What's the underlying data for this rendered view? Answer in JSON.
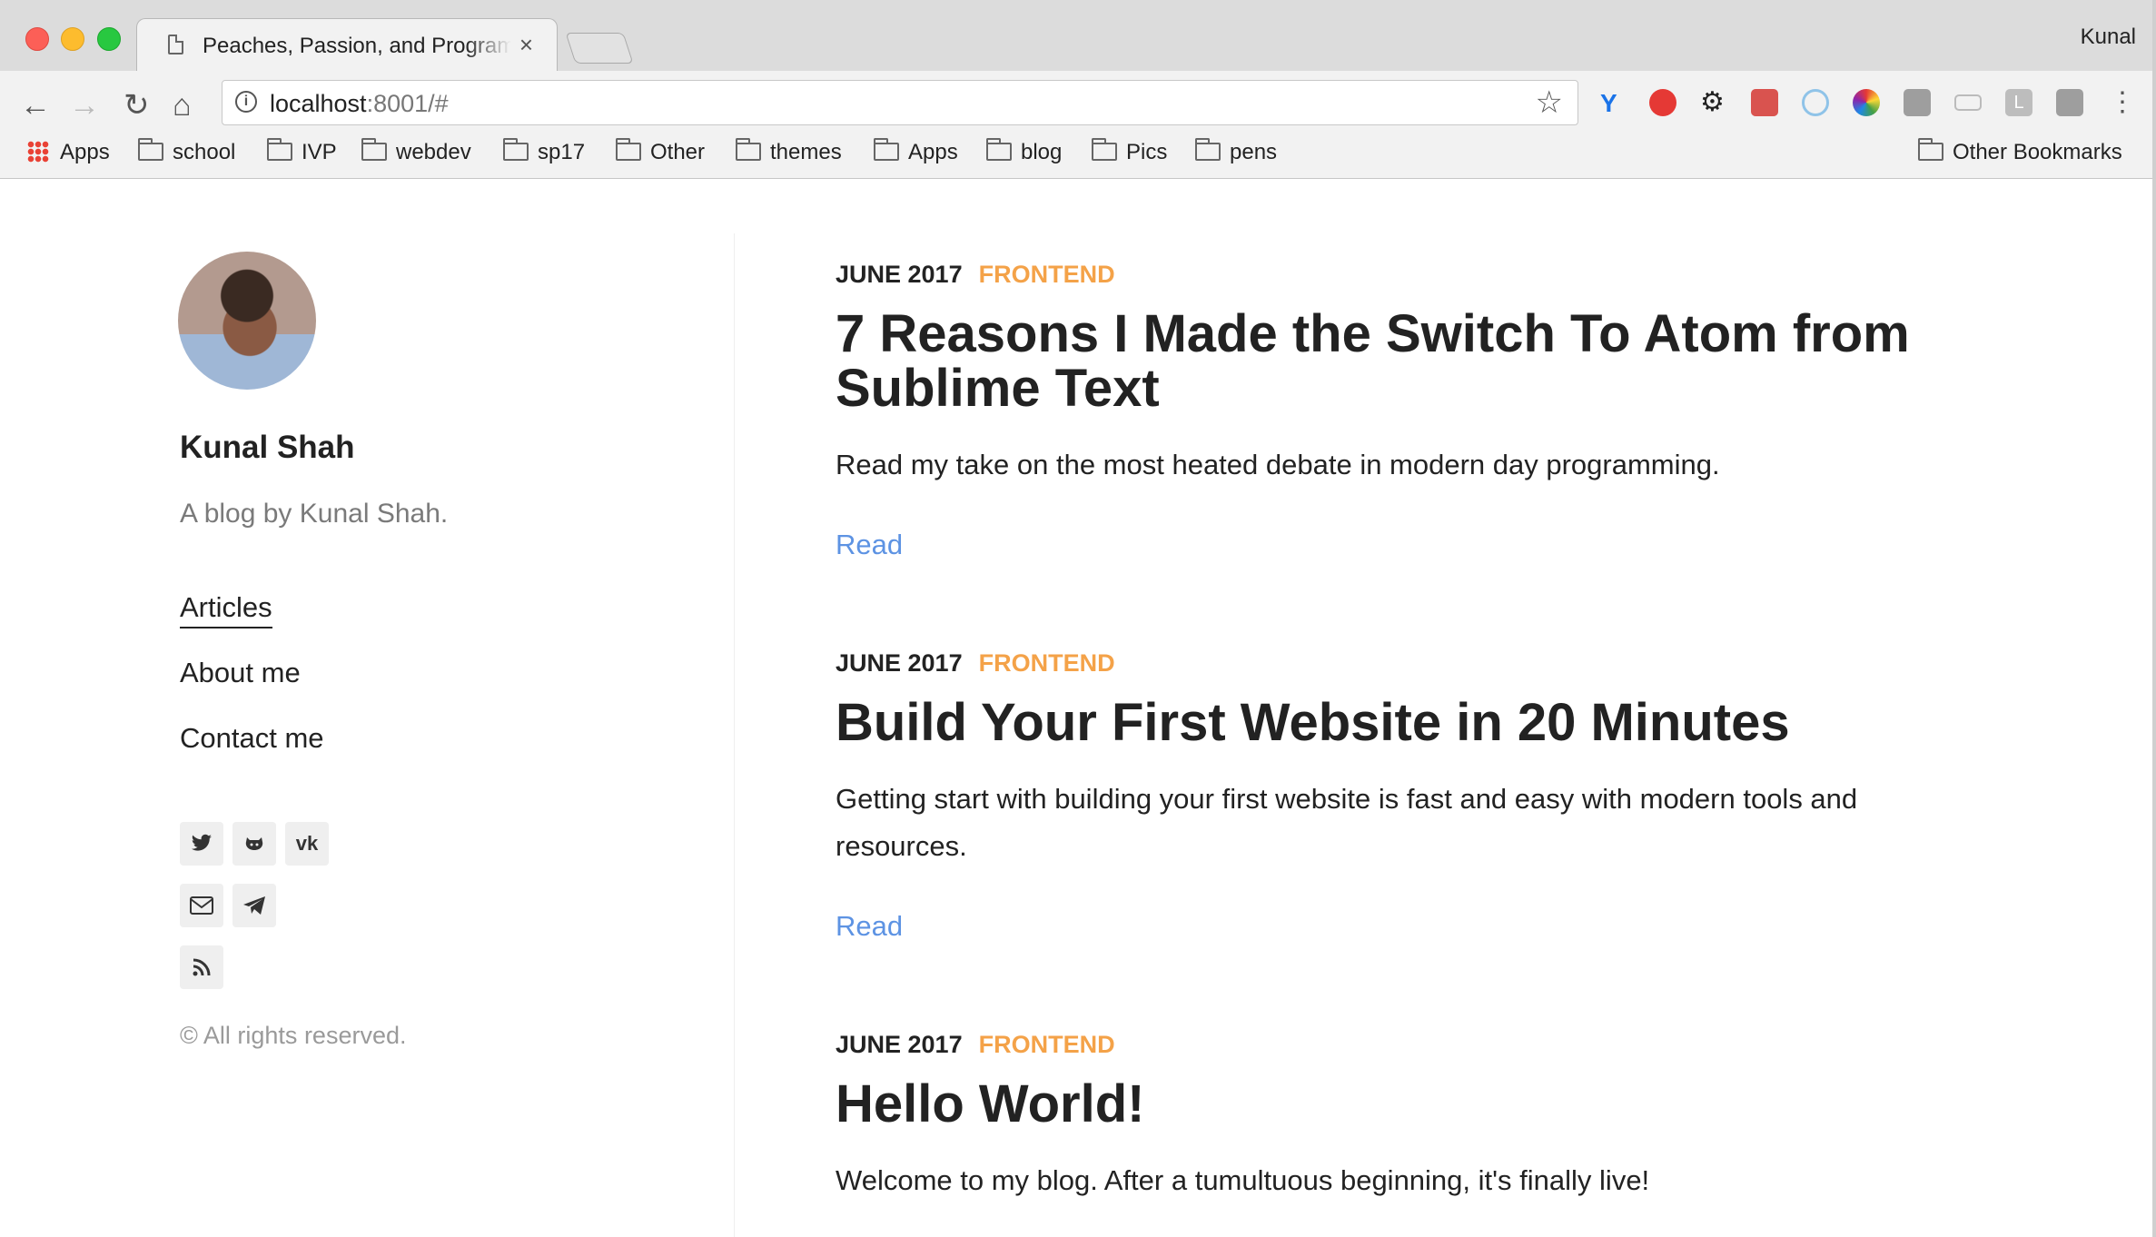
{
  "browser": {
    "tab_title": "Peaches, Passion, and Programming",
    "profile": "Kunal",
    "url_host": "localhost",
    "url_rest": ":8001/#",
    "bookmarks": [
      "Apps",
      "school",
      "IVP",
      "webdev",
      "sp17",
      "Other",
      "themes",
      "Apps",
      "blog",
      "Pics",
      "pens"
    ],
    "other_bookmarks": "Other Bookmarks"
  },
  "sidebar": {
    "name": "Kunal Shah",
    "subtitle": "A blog by Kunal Shah.",
    "nav": [
      "Articles",
      "About me",
      "Contact me"
    ],
    "social_icons": [
      "twitter-icon",
      "github-icon",
      "vk-icon",
      "email-icon",
      "telegram-icon",
      "rss-icon"
    ],
    "copyright": "© All rights reserved."
  },
  "articles": [
    {
      "date": "JUNE 2017",
      "category": "FRONTEND",
      "title": "7 Reasons I Made the Switch To Atom from Sublime Text",
      "excerpt": "Read my take on the most heated debate in modern day programming.",
      "read": "Read"
    },
    {
      "date": "JUNE 2017",
      "category": "FRONTEND",
      "title": "Build Your First Website in 20 Minutes",
      "excerpt": "Getting start with building your first website is fast and easy with modern tools and resources.",
      "read": "Read"
    },
    {
      "date": "JUNE 2017",
      "category": "FRONTEND",
      "title": "Hello World!",
      "excerpt": "Welcome to my blog. After a tumultuous beginning, it's finally live!"
    }
  ],
  "colors": {
    "accent": "#f4a248",
    "link": "#5d93e3"
  }
}
